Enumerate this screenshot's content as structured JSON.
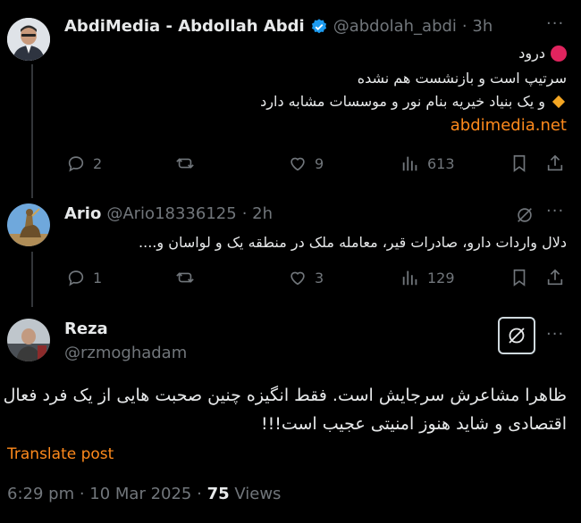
{
  "tweets": [
    {
      "name": "AbdiMedia - Abdollah Abdi",
      "handle": "@abdolah_abdi",
      "time": "· 3h",
      "lines": [
        "درود",
        "سرتیپ است و بازنشست هم نشده",
        "و یک بنیاد خیریه بنام نور و موسسات مشابه دارد"
      ],
      "link": "abdimedia.net",
      "actions": {
        "replies": "2",
        "likes": "9",
        "views": "613"
      }
    },
    {
      "name": "Ario",
      "handle": "@Ario18336125",
      "time": "· 2h",
      "lines": [
        "دلال واردات دارو، صادرات قیر، معامله ملک در منطقه یک و لواسان و...."
      ],
      "actions": {
        "replies": "1",
        "likes": "3",
        "views": "129"
      }
    }
  ],
  "main": {
    "name": "Reza",
    "handle": "@rzmoghadam",
    "lines": [
      "ظاهرا مشاعرش سرجایش است. فقط انگیزه چنین صحبت هایی از یک فرد فعال",
      "اقتصادی و شاید هنوز امنیتی عجیب است!!!"
    ],
    "translate": "Translate post",
    "date": "6:29 pm · 10 Mar 2025 · ",
    "views_count": "75",
    "views_label": " Views"
  },
  "colors": {
    "accent": "#ff8a1c",
    "verified": "#1d9bf0",
    "muted": "#71767b"
  }
}
